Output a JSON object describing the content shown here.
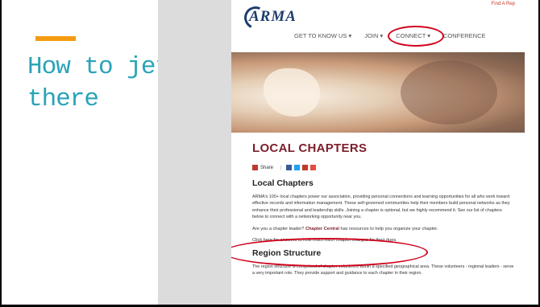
{
  "slide": {
    "title": "How to jet\nthere",
    "accent_color": "#f39c12",
    "title_color": "#2aa3b8"
  },
  "site": {
    "logo": "ARMA",
    "top_link": "Find A Rep",
    "nav": [
      {
        "label": "GET TO KNOW US ▾"
      },
      {
        "label": "JOIN ▾"
      },
      {
        "label": "CONNECT ▾"
      },
      {
        "label": "CONFERENCE"
      }
    ],
    "page_heading": "LOCAL CHAPTERS",
    "share_label": "Share",
    "section1_heading": "Local Chapters",
    "section1_text": "ARMA's 100+ local chapters power our association, providing personal connections and learning opportunities for all who work toward effective records and information management. These self-governed communities help their members build personal networks as they enhance their professional and leadership skills. Joining a chapter is optional, but we highly recommend it. See our list of chapters below to connect with a networking opportunity near you.",
    "chapter_leader_prefix": "Are you a chapter leader? ",
    "chapter_central_link": "Chapter Central",
    "chapter_leader_suffix": " has resources to help you organize your chapter.",
    "click_here_line": "Click here for answers to how much each chapter charges for their dues.",
    "section2_heading": "Region Structure",
    "section2_text": "The region structure is comprised of chapter volunteers within a specified geographical area. These volunteers - regional leaders - serve a very important role. They provide support and guidance to each chapter in their region.",
    "accent_red": "#d0021b",
    "brand_maroon": "#7b1f2a"
  }
}
